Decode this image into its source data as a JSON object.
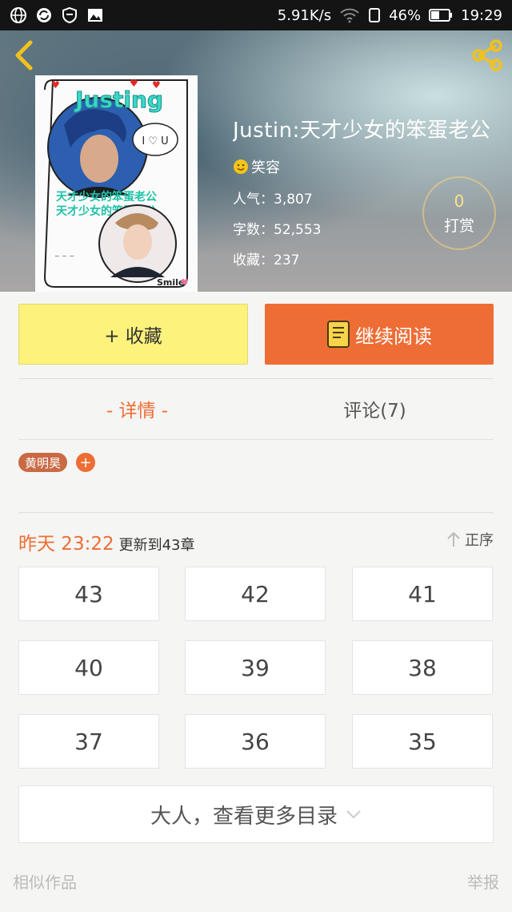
{
  "status_bar": {
    "speed": "5.91K/s",
    "battery": "46%",
    "time": "19:29"
  },
  "book": {
    "title": "Justin:天才少女的笨蛋老公",
    "author": "笑容",
    "popularity_label": "人气：",
    "popularity": "3,807",
    "word_count_label": "字数：",
    "word_count": "52,553",
    "favorites_label": "收藏：",
    "favorites": "237",
    "cover_texts": {
      "name": "Justing",
      "love_bubble": "I ♡ U",
      "line1": "天才少女的笨蛋老公",
      "line2": "天才少女的笨蛋老公",
      "smile": "Smile"
    }
  },
  "tip": {
    "count": "0",
    "label": "打赏"
  },
  "actions": {
    "favorite_label": "+ 收藏",
    "read_label": "继续阅读"
  },
  "tabs": {
    "details": "- 详情 -",
    "comments": "评论(7)"
  },
  "tags": [
    "黄明昊"
  ],
  "tag_add": "+",
  "chapters": {
    "update_time": "昨天 23:22",
    "update_text": "更新到43章",
    "sort_label": "正序",
    "items": [
      "43",
      "42",
      "41",
      "40",
      "39",
      "38",
      "37",
      "36",
      "35"
    ],
    "more_label": "大人，查看更多目录"
  },
  "footer": {
    "similar": "相似作品",
    "report": "举报"
  },
  "colors": {
    "accent": "#ee6d35",
    "favorite_bg": "#fcf27c",
    "tag_bg": "#c96a45"
  }
}
